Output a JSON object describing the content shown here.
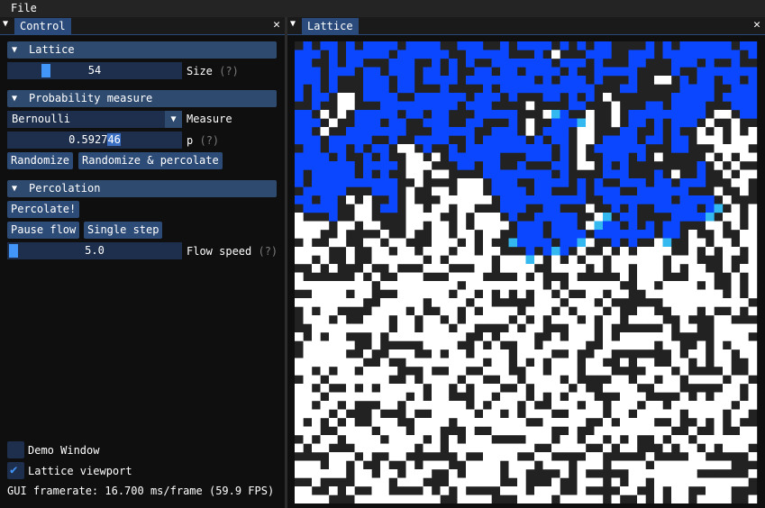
{
  "menubar": {
    "file_label": "File"
  },
  "control_window": {
    "tab_label": "Control",
    "close_glyph": "✕",
    "lattice_section": {
      "header": "Lattice",
      "size_value": "54",
      "size_fraction": 0.2,
      "size_label": "Size",
      "help_hint": "(?)"
    },
    "probability_section": {
      "header": "Probability measure",
      "measure_value": "Bernoulli",
      "measure_label": "Measure",
      "p_value_before": "0.5927",
      "p_value_selected": "46",
      "p_label": "p",
      "p_hint": "(?)",
      "randomize_button": "Randomize",
      "randomize_percolate_button": "Randomize & percolate"
    },
    "percolation_section": {
      "header": "Percolation",
      "percolate_button": "Percolate!",
      "pause_button": "Pause flow",
      "single_step_button": "Single step",
      "flow_speed_value": "5.0",
      "flow_speed_fraction": 0.0,
      "flow_speed_label": "Flow speed",
      "flow_speed_hint": "(?)"
    },
    "demo_window_label": "Demo Window",
    "demo_window_checked": false,
    "lattice_viewport_label": "Lattice viewport",
    "lattice_viewport_checked": true,
    "framerate_text": "GUI framerate: 16.700 ms/frame (59.9 FPS)"
  },
  "lattice_window": {
    "tab_label": "Lattice",
    "close_glyph": "✕",
    "grid_size": 54,
    "colors": {
      "open": "#ffffff",
      "closed": "#222222",
      "flooded": "#0a47ff",
      "front": "#34b8f0"
    },
    "open_probability": 0.592746
  },
  "theme": {
    "accent": "#4296fa",
    "header_bg": "#2f4a6f",
    "frame_bg": "#1d2f4c"
  }
}
